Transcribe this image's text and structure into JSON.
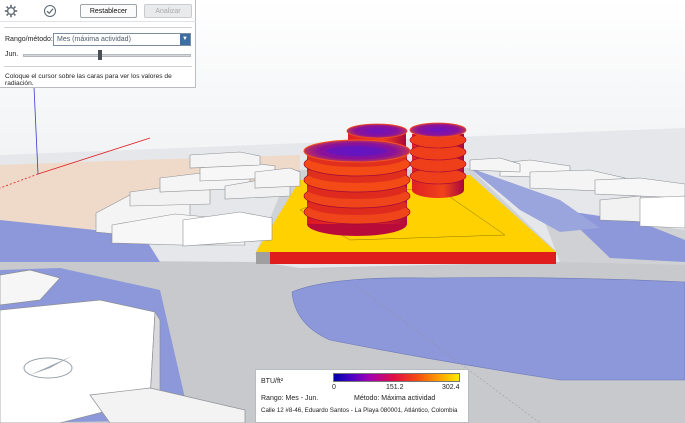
{
  "toolbar": {
    "reset_label": "Restablecer",
    "analyze_label": "Analizar"
  },
  "controls": {
    "range_label": "Rango/método:",
    "range_value": "Mes (máxima actividad)",
    "slider_label": "Jun.",
    "slider_position": 0.46,
    "hint": "Coloque el cursor sobre las caras para ver los valores de radiación."
  },
  "legend": {
    "unit": "BTU/ft²",
    "scale_min": "0",
    "scale_mid": "151.2",
    "scale_max": "302.4",
    "range_text": "Rango: Mes - Jun.",
    "method_text": "Método: Máxima actividad",
    "address": "Calle 12 #8-46, Eduardo Santos - La Playa 080001, Atlántico, Colombia"
  },
  "colors": {
    "ground": "#e3e5e8",
    "road": "#c4c6c9",
    "water": "#8c98d9",
    "site": "#ffd700",
    "building": "#f6f6f6",
    "panel_bg": "#ffffff",
    "accent": "#3c6ea3"
  },
  "icons": [
    "settings-gear-icon",
    "checkmark-icon",
    "chevron-down-icon"
  ]
}
